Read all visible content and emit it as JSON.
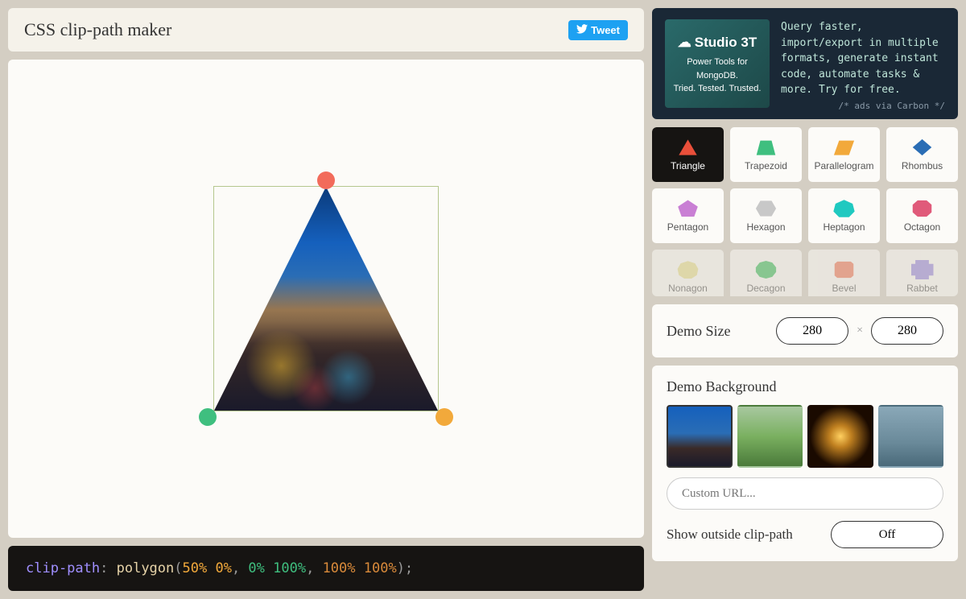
{
  "header": {
    "title": "CSS clip-path maker",
    "tweet_label": "Tweet"
  },
  "canvas": {
    "clip_path_points": [
      "50% 0%",
      "0% 100%",
      "100% 100%"
    ],
    "handles": [
      {
        "name": "handle-top",
        "color": "#f26b5b"
      },
      {
        "name": "handle-bottom-left",
        "color": "#3fbf7f"
      },
      {
        "name": "handle-bottom-right",
        "color": "#f2a93b"
      }
    ]
  },
  "code": {
    "property": "clip-path",
    "function": "polygon",
    "args": [
      {
        "text": "50% 0%",
        "color": "#f2a93b"
      },
      {
        "text": "0% 100%",
        "color": "#3fbf7f"
      },
      {
        "text": "100% 100%",
        "color": "#d98a3a"
      }
    ]
  },
  "ad": {
    "brand": "Studio 3T",
    "tagline1": "Power Tools for MongoDB.",
    "tagline2": "Tried. Tested. Trusted.",
    "copy": "Query faster, import/export in multiple formats, generate instant code, automate tasks & more. Try for free.",
    "attribution": "/* ads via Carbon */"
  },
  "shapes": [
    {
      "label": "Triangle",
      "color": "#e94f3a",
      "path": "polygon(50% 10%, 10% 90%, 90% 90%)",
      "active": true
    },
    {
      "label": "Trapezoid",
      "color": "#3fbf7f",
      "path": "polygon(25% 15%, 75% 15%, 92% 90%, 8% 90%)"
    },
    {
      "label": "Parallelogram",
      "color": "#f2a93b",
      "path": "polygon(28% 15%, 95% 15%, 72% 90%, 5% 90%)"
    },
    {
      "label": "Rhombus",
      "color": "#2a6db5",
      "path": "polygon(50% 8%, 92% 50%, 50% 92%, 8% 50%)"
    },
    {
      "label": "Pentagon",
      "color": "#c97fd4",
      "path": "polygon(50% 6%, 94% 40%, 78% 92%, 22% 92%, 6% 40%)"
    },
    {
      "label": "Hexagon",
      "color": "#c8c8c8",
      "path": "polygon(25% 10%, 75% 10%, 95% 50%, 75% 90%, 25% 90%, 5% 50%)"
    },
    {
      "label": "Heptagon",
      "color": "#1fc9c0",
      "path": "polygon(50% 5%, 88% 25%, 97% 65%, 72% 95%, 28% 95%, 3% 65%, 12% 25%)"
    },
    {
      "label": "Octagon",
      "color": "#e05a7a",
      "path": "polygon(30% 8%, 70% 8%, 92% 30%, 92% 70%, 70% 92%, 30% 92%, 8% 70%, 8% 30%)"
    },
    {
      "label": "Nonagon",
      "color": "#e8e090",
      "path": "polygon(50% 5%, 82% 17%, 96% 46%, 90% 78%, 66% 96%, 34% 96%, 10% 78%, 4% 46%, 18% 17%)",
      "faded": true
    },
    {
      "label": "Decagon",
      "color": "#3fbf5f",
      "path": "polygon(50% 4%, 78% 13%, 95% 38%, 95% 62%, 78% 87%, 50% 96%, 22% 87%, 5% 62%, 5% 38%, 22% 13%)",
      "faded": true
    },
    {
      "label": "Bevel",
      "color": "#f07a5a",
      "path": "polygon(20% 8%, 80% 8%, 92% 20%, 92% 80%, 80% 92%, 20% 92%, 8% 80%, 8% 20%)",
      "faded": true
    },
    {
      "label": "Rabbet",
      "color": "#9a8ae0",
      "path": "polygon(0 20%, 20% 20%, 20% 0, 80% 0, 80% 20%, 100% 20%, 100% 80%, 80% 80%, 80% 100%, 20% 100%, 20% 80%, 0 80%)",
      "faded": true
    }
  ],
  "demo_size": {
    "label": "Demo Size",
    "width": "280",
    "height": "280"
  },
  "demo_bg": {
    "label": "Demo Background",
    "url_placeholder": "Custom URL...",
    "show_outside_label": "Show outside clip-path",
    "toggle_value": "Off"
  }
}
